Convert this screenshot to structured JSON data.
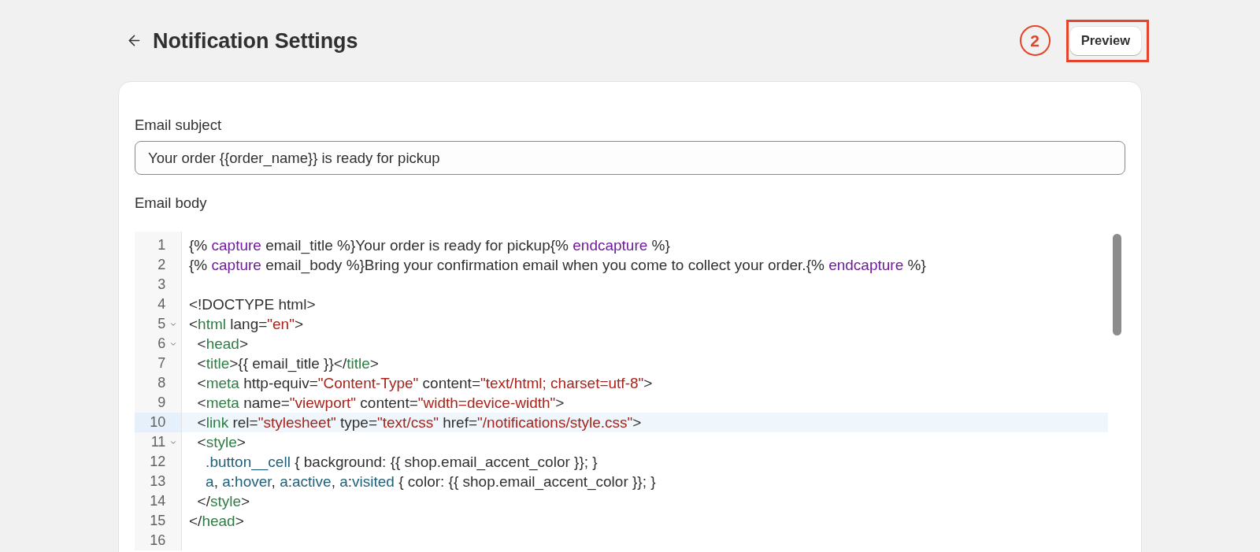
{
  "header": {
    "title": "Notification Settings",
    "step_badge": "2",
    "preview_button": {
      "label": "Preview",
      "highlighted": true
    }
  },
  "subject": {
    "label": "Email subject",
    "value": "Your order {{order_name}} is ready for pickup"
  },
  "body": {
    "label": "Email body",
    "editor": {
      "lines": [
        {
          "number": "1",
          "selected": false,
          "tokens": [
            {
              "kind": "text",
              "text": "{% "
            },
            {
              "kind": "keyword",
              "text": "capture"
            },
            {
              "kind": "text",
              "text": " email_title %}Your order is ready for pickup{% "
            },
            {
              "kind": "keyword",
              "text": "endcapture"
            },
            {
              "kind": "text",
              "text": " %}"
            }
          ]
        },
        {
          "number": "2",
          "selected": false,
          "tokens": [
            {
              "kind": "text",
              "text": "{% "
            },
            {
              "kind": "keyword",
              "text": "capture"
            },
            {
              "kind": "text",
              "text": " email_body %}Bring your confirmation email when you come to collect your order.{% "
            },
            {
              "kind": "keyword",
              "text": "endcapture"
            },
            {
              "kind": "text",
              "text": " %}"
            }
          ]
        },
        {
          "number": "3",
          "selected": false
        },
        {
          "number": "4",
          "selected": false,
          "tokens": [
            {
              "kind": "text",
              "text": "<!DOCTYPE html>"
            }
          ]
        },
        {
          "number": "5",
          "selected": false,
          "expanded": true,
          "tokens": [
            {
              "kind": "text",
              "text": "<"
            },
            {
              "kind": "tag",
              "text": "html"
            },
            {
              "kind": "text",
              "text": " lang="
            },
            {
              "kind": "string",
              "text": "\"en\""
            },
            {
              "kind": "text",
              "text": ">"
            }
          ]
        },
        {
          "number": "6",
          "selected": false,
          "expanded": true,
          "tokens": [
            {
              "kind": "text",
              "text": "  <"
            },
            {
              "kind": "tag",
              "text": "head"
            },
            {
              "kind": "text",
              "text": ">"
            }
          ]
        },
        {
          "number": "7",
          "selected": false,
          "tokens": [
            {
              "kind": "text",
              "text": "  <"
            },
            {
              "kind": "tag",
              "text": "title"
            },
            {
              "kind": "text",
              "text": ">{{ email_title }}</"
            },
            {
              "kind": "tag",
              "text": "title"
            },
            {
              "kind": "text",
              "text": ">"
            }
          ]
        },
        {
          "number": "8",
          "selected": false,
          "tokens": [
            {
              "kind": "text",
              "text": "  <"
            },
            {
              "kind": "tag",
              "text": "meta"
            },
            {
              "kind": "text",
              "text": " http-equiv="
            },
            {
              "kind": "string",
              "text": "\"Content-Type\""
            },
            {
              "kind": "text",
              "text": " content="
            },
            {
              "kind": "string",
              "text": "\"text/html; charset=utf-8\""
            },
            {
              "kind": "text",
              "text": ">"
            }
          ]
        },
        {
          "number": "9",
          "selected": false,
          "tokens": [
            {
              "kind": "text",
              "text": "  <"
            },
            {
              "kind": "tag",
              "text": "meta"
            },
            {
              "kind": "text",
              "text": " name="
            },
            {
              "kind": "string",
              "text": "\"viewport\""
            },
            {
              "kind": "text",
              "text": " content="
            },
            {
              "kind": "string",
              "text": "\"width=device-width\""
            },
            {
              "kind": "text",
              "text": ">"
            }
          ]
        },
        {
          "number": "10",
          "selected": true,
          "tokens": [
            {
              "kind": "text",
              "text": "  <"
            },
            {
              "kind": "tag",
              "text": "link"
            },
            {
              "kind": "text",
              "text": " rel="
            },
            {
              "kind": "string",
              "text": "\"stylesheet\""
            },
            {
              "kind": "text",
              "text": " type="
            },
            {
              "kind": "string",
              "text": "\"text/css\""
            },
            {
              "kind": "text",
              "text": " href="
            },
            {
              "kind": "string",
              "text": "\"/notifications/style.css\""
            },
            {
              "kind": "text",
              "text": ">"
            }
          ]
        },
        {
          "number": "11",
          "selected": false,
          "expanded": true,
          "tokens": [
            {
              "kind": "text",
              "text": "  <"
            },
            {
              "kind": "tag",
              "text": "style"
            },
            {
              "kind": "text",
              "text": ">"
            }
          ]
        },
        {
          "number": "12",
          "selected": false,
          "tokens": [
            {
              "kind": "selector",
              "text": "    .button__cell"
            },
            {
              "kind": "text",
              "text": " { background: {{ shop.email_accent_color }}; }"
            }
          ]
        },
        {
          "number": "13",
          "selected": false,
          "tokens": [
            {
              "kind": "selector",
              "text": "    a"
            },
            {
              "kind": "text",
              "text": ", "
            },
            {
              "kind": "selector",
              "text": "a"
            },
            {
              "kind": "text",
              "text": ":"
            },
            {
              "kind": "selector",
              "text": "hover"
            },
            {
              "kind": "text",
              "text": ", "
            },
            {
              "kind": "selector",
              "text": "a"
            },
            {
              "kind": "text",
              "text": ":"
            },
            {
              "kind": "selector",
              "text": "active"
            },
            {
              "kind": "text",
              "text": ", "
            },
            {
              "kind": "selector",
              "text": "a"
            },
            {
              "kind": "text",
              "text": ":"
            },
            {
              "kind": "selector",
              "text": "visited"
            },
            {
              "kind": "text",
              "text": " { color: {{ shop.email_accent_color }}; }"
            }
          ]
        },
        {
          "number": "14",
          "selected": false,
          "tokens": [
            {
              "kind": "text",
              "text": "  </"
            },
            {
              "kind": "tag",
              "text": "style"
            },
            {
              "kind": "text",
              "text": ">"
            }
          ]
        },
        {
          "number": "15",
          "selected": false,
          "tokens": [
            {
              "kind": "text",
              "text": "</"
            },
            {
              "kind": "tag",
              "text": "head"
            },
            {
              "kind": "text",
              "text": ">"
            }
          ]
        },
        {
          "number": "16",
          "selected": false
        }
      ]
    }
  }
}
